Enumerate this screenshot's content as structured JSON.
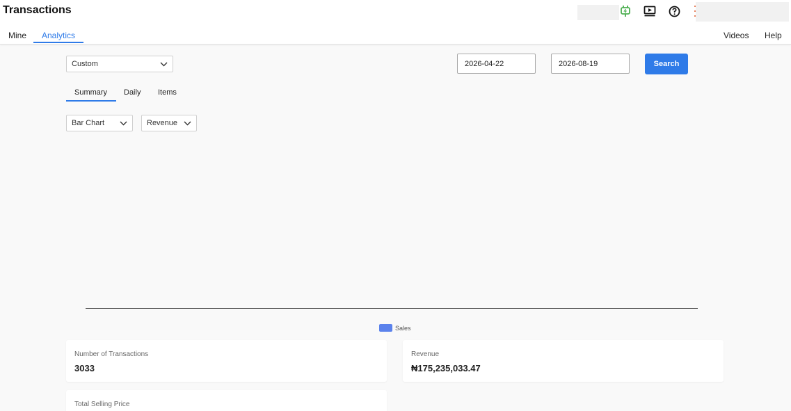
{
  "header": {
    "title": "Transactions",
    "tabs": [
      {
        "label": "Mine"
      },
      {
        "label": "Analytics"
      }
    ],
    "links": [
      {
        "label": "Videos"
      },
      {
        "label": "Help"
      }
    ],
    "icons": [
      "plug-icon",
      "video-player-icon",
      "help-circle-icon",
      "more-vert-icon"
    ]
  },
  "filters": {
    "range_select": "Custom",
    "start_date": "2026-04-22",
    "end_date": "2026-08-19",
    "search_label": "Search"
  },
  "subtabs": [
    {
      "label": "Summary"
    },
    {
      "label": "Daily"
    },
    {
      "label": "Items"
    }
  ],
  "chart_controls": {
    "chart_type": "Bar Chart",
    "metric": "Revenue"
  },
  "chart_data": {
    "type": "bar",
    "categories": [],
    "series": [
      {
        "name": "Sales",
        "values": [],
        "color": "#5b82ec"
      }
    ]
  },
  "stats": [
    {
      "label": "Number of Transactions",
      "value": "3033"
    },
    {
      "label": "Revenue",
      "value": "₦175,235,033.47"
    },
    {
      "label": "Total Selling Price",
      "value": ""
    }
  ],
  "colors": {
    "accent": "#2f7be8",
    "plug_icon": "#4caf50"
  }
}
